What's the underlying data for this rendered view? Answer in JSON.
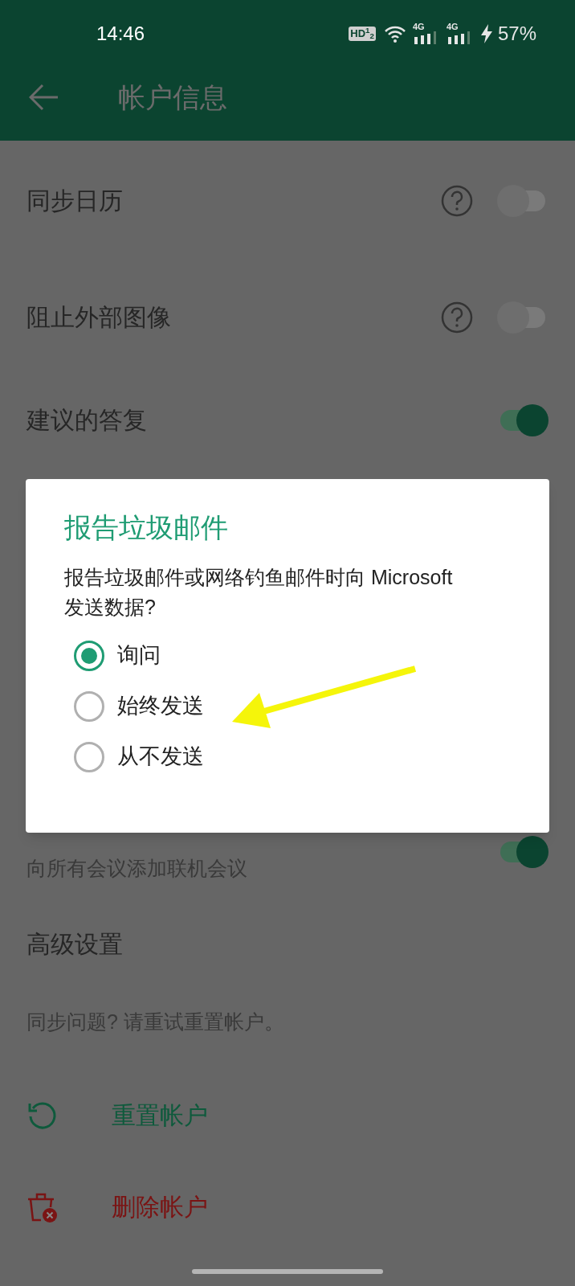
{
  "status_bar": {
    "time": "14:46",
    "hd_badge": "HD$^{1}$$_{2}$",
    "networks": [
      "4G",
      "4G"
    ],
    "battery": "57%"
  },
  "app_bar": {
    "title": "帐户信息"
  },
  "settings": [
    {
      "kind": "toggle",
      "title": "同步日历",
      "help": true,
      "on": false
    },
    {
      "kind": "toggle",
      "title": "阻止外部图像",
      "help": true,
      "on": false
    },
    {
      "kind": "toggle",
      "title": "建议的答复",
      "help": false,
      "on": true
    },
    {
      "kind": "toggle",
      "subtitle": "向所有会议添加联机会议",
      "help": false,
      "on": true
    }
  ],
  "advanced": {
    "heading": "高级设置",
    "note": "同步问题? 请重试重置帐户。",
    "actions": [
      {
        "kind": "reset",
        "label": "重置帐户"
      },
      {
        "kind": "delete",
        "label": "删除帐户"
      }
    ]
  },
  "dialog": {
    "title": "报告垃圾邮件",
    "message": "报告垃圾邮件或网络钓鱼邮件时向 Microsoft 发送数据?",
    "options": [
      {
        "label": "询问",
        "selected": true
      },
      {
        "label": "始终发送",
        "selected": false
      },
      {
        "label": "从不发送",
        "selected": false
      }
    ]
  }
}
